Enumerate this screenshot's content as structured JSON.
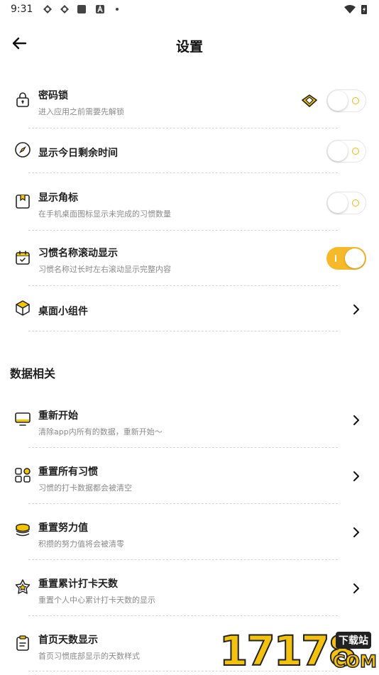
{
  "status_bar": {
    "time": "9:31"
  },
  "header": {
    "title": "设置",
    "back_icon": "arrow-left-icon"
  },
  "settings": {
    "password_lock": {
      "label": "密码锁",
      "desc": "进入应用之前需要先解锁",
      "premium_icon": "diamond-icon",
      "enabled": false
    },
    "show_remaining_time": {
      "label": "显示今日剩余时间",
      "enabled": false
    },
    "show_badge": {
      "label": "显示角标",
      "desc": "在手机桌面图标显示未完成的习惯数量",
      "enabled": false
    },
    "scroll_habit_name": {
      "label": "习惯名称滚动显示",
      "desc": "习惯名称过长时左右滚动显示完整内容",
      "enabled": true
    },
    "desktop_widget": {
      "label": "桌面小组件"
    }
  },
  "data_section": {
    "title": "数据相关",
    "items": [
      {
        "label": "重新开始",
        "desc": "清除app内所有的数据，重新开始～",
        "icon": "monitor-icon"
      },
      {
        "label": "重置所有习惯",
        "desc": "习惯的打卡数据都会被清空",
        "icon": "grid-icon"
      },
      {
        "label": "重置努力值",
        "desc": "积攒的努力值将会被清零",
        "icon": "coins-icon"
      },
      {
        "label": "重置累计打卡天数",
        "desc": "重置个人中心累计打卡天数的显示",
        "icon": "star-badge-icon"
      },
      {
        "label": "首页天数显示",
        "desc": "首页习惯底部显示的天数样式",
        "icon": "clipboard-icon"
      }
    ]
  },
  "watermark": {
    "number": "17178",
    "tag": "下载站",
    "domain": "COM"
  },
  "colors": {
    "accent": "#f5b92a",
    "divider": "#d6d6d6"
  }
}
